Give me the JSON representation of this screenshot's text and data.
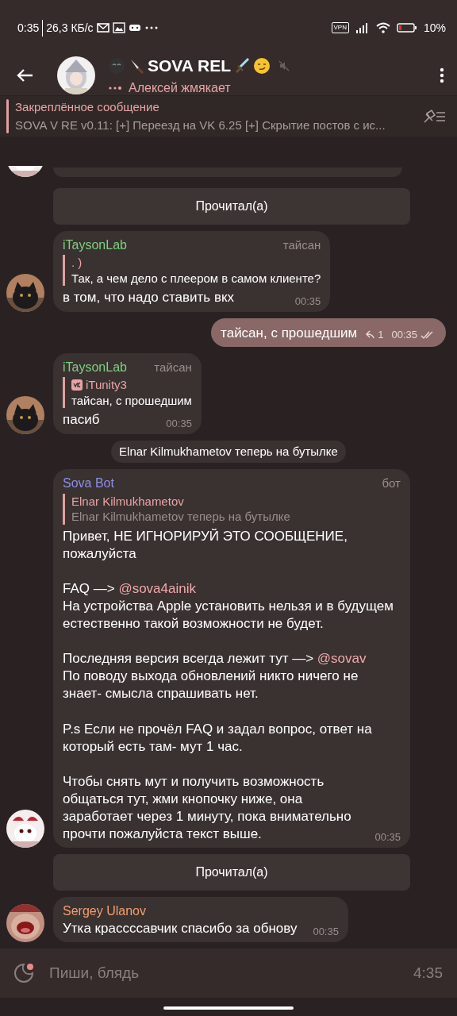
{
  "status_bar": {
    "time": "0:35",
    "speed": "26,3 КБ/с",
    "vpn": "VPN",
    "battery": "10%"
  },
  "header": {
    "title": "SOVA REL",
    "muted": true,
    "typing": "Алексей жмякает"
  },
  "pinned": {
    "label": "Закреплённое сообщение",
    "text": "SOVA V RE v0.11: [+] Переезд на VK 6.25 [+] Скрытие постов с ис..."
  },
  "messages": [
    {
      "kind": "cut"
    },
    {
      "kind": "button",
      "label": "Прочитал(а)"
    },
    {
      "kind": "incoming",
      "sender": "iTaysonLab",
      "color": "#7fcf7f",
      "role": "тайсан",
      "reply": {
        "author": ". )",
        "vk": false,
        "text": "Так, а чем дело с плеером в самом клиенте?"
      },
      "paragraphs": [
        [
          [
            {
              "text": "в том, что надо ставить вкх"
            }
          ]
        ]
      ],
      "time": "00:35"
    },
    {
      "kind": "outgoing",
      "text": "тайсан, с прошедшим",
      "replies": "1",
      "time": "00:35",
      "read": true
    },
    {
      "kind": "incoming",
      "sender": "iTaysonLab",
      "color": "#7fcf7f",
      "role": "тайсан",
      "reply": {
        "author": "iTunity3",
        "vk": true,
        "text": "тайсан, с прошедшим"
      },
      "paragraphs": [
        [
          [
            {
              "text": "пасиб"
            }
          ]
        ]
      ],
      "time": "00:35"
    },
    {
      "kind": "service",
      "text": "Elnar Kilmukhametov теперь на бутылке"
    },
    {
      "kind": "incoming",
      "sender": "Sova Bot",
      "color": "#8e8ee8",
      "role": "бот",
      "reply": {
        "author": "Elnar Kilmukhametov",
        "vk": false,
        "text": "Elnar Kilmukhametov теперь на бутылке",
        "dim": true
      },
      "paragraphs": [
        [
          [
            {
              "text": "Привет, НЕ ИГНОРИРУЙ ЭТО СООБЩЕНИЕ, пожалуйста"
            }
          ]
        ],
        [
          [
            {
              "text": "FAQ —> "
            },
            {
              "text": "@sova4ainik",
              "link": true
            }
          ],
          [
            {
              "text": "На устройства Apple установить нельзя и в будущем естественно такой возможности не будет."
            }
          ]
        ],
        [
          [
            {
              "text": "Последняя версия всегда лежит тут —> "
            },
            {
              "text": "@sovav",
              "link": true
            }
          ],
          [
            {
              "text": "По поводу выхода обновлений никто ничего не знает- смысла спрашивать нет."
            }
          ]
        ],
        [
          [
            {
              "text": "P.s Если не прочёл FAQ и задал вопрос, ответ на который есть там- мут 1 час."
            }
          ]
        ],
        [
          [
            {
              "text": "Чтобы снять мут и получить возможность общаться тут, жми кнопочку ниже, она заработает через 1 минуту, пока внимательно прочти пожалуйста текст выше."
            }
          ]
        ]
      ],
      "time": "00:35"
    },
    {
      "kind": "button",
      "label": "Прочитал(а)"
    },
    {
      "kind": "incoming",
      "sender": "Sergey Ulanov",
      "color": "#f0a070",
      "paragraphs": [
        [
          [
            {
              "text": "Утка крассссавчик спасибо за обнову"
            }
          ]
        ]
      ],
      "time": "00:35"
    }
  ],
  "composer": {
    "placeholder": "Пиши, блядь",
    "timer": "4:35"
  }
}
